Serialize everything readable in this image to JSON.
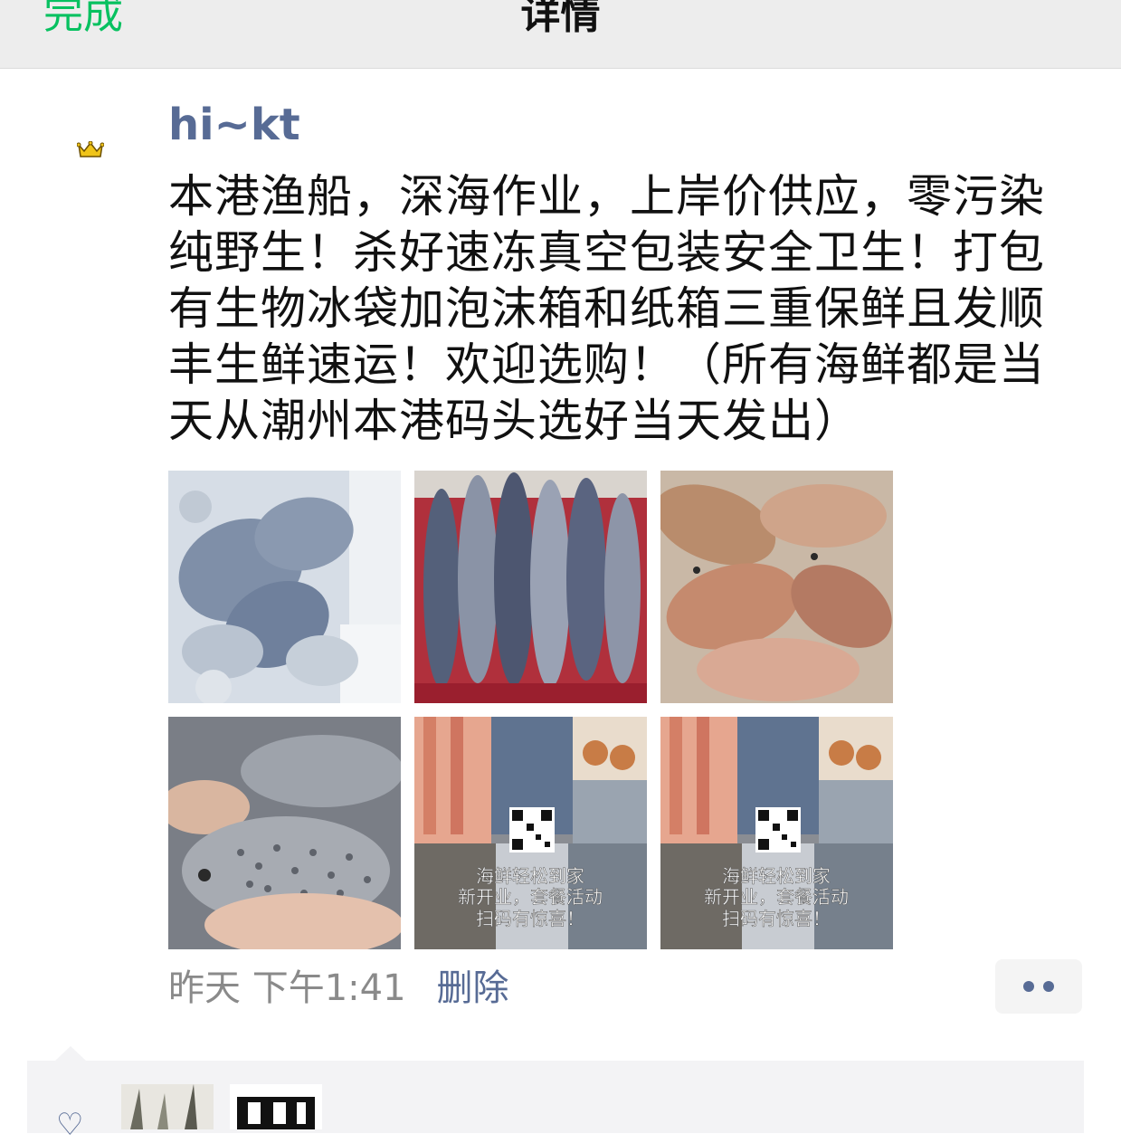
{
  "header": {
    "done_label": "完成",
    "title": "详情",
    "accent_color": "#07c160"
  },
  "post": {
    "username": "hi~kt",
    "avatar_icon": "crown-icon",
    "text": "本港渔船，深海作业，上岸价供应，零污染纯野生！杀好速冻真空包装安全卫生！打包有生物冰袋加泡沫箱和纸箱三重保鲜且发顺丰生鲜速运！欢迎选购！（所有海鲜都是当天从潮州本港码头选好当天发出）",
    "images": [
      {
        "name": "photo-fish-on-ice"
      },
      {
        "name": "photo-mackerel"
      },
      {
        "name": "photo-parrotfish"
      },
      {
        "name": "photo-spotted-fish-in-hand"
      },
      {
        "name": "photo-promo-collage-1"
      },
      {
        "name": "photo-promo-collage-2"
      }
    ],
    "promo_lines": [
      "海鲜轻松到家",
      "新开业，套餐活动",
      "扫码有惊喜！"
    ],
    "timestamp": "昨天 下午1:41",
    "delete_label": "删除",
    "more_icon": "more-dots-icon"
  },
  "comments": {
    "like_icon": "heart-icon",
    "liker_count_visible": 2
  }
}
